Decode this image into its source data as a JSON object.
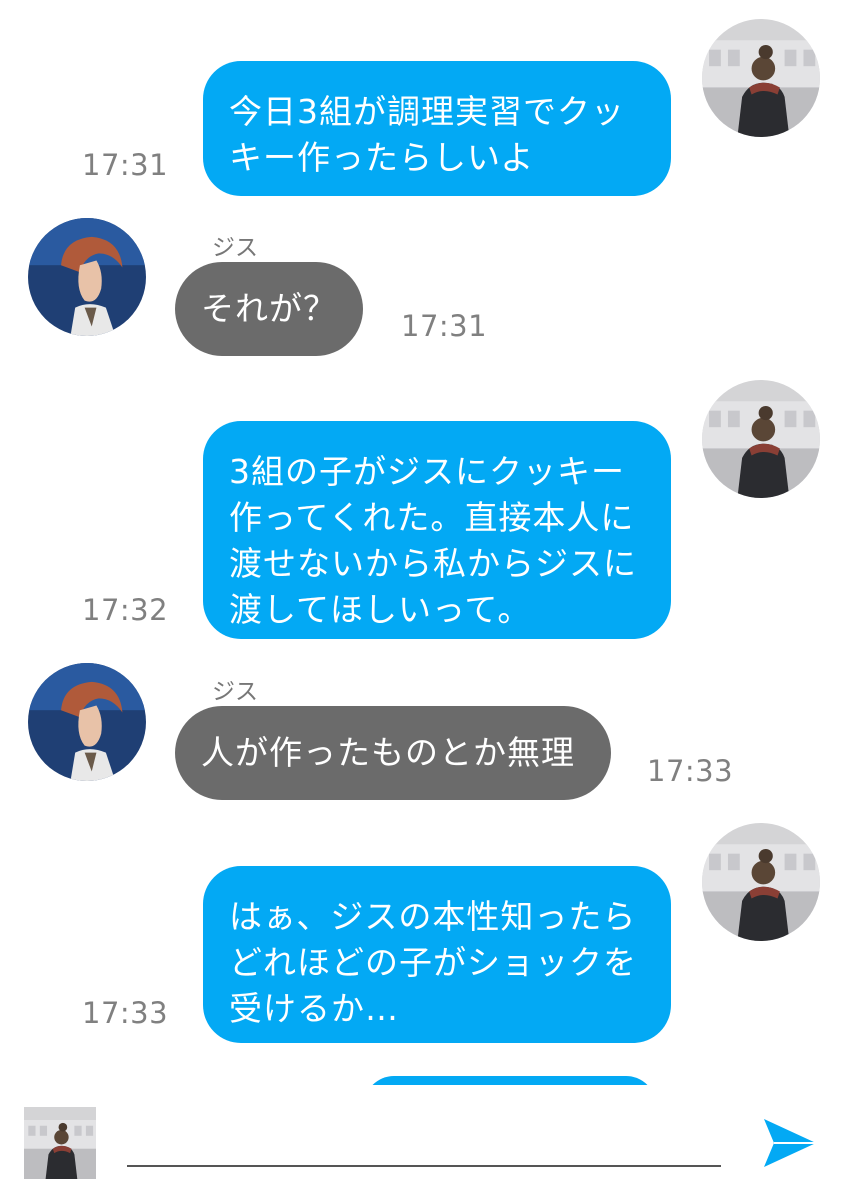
{
  "colors": {
    "my_bubble": "#03a9f4",
    "their_bubble": "#6b6b6b",
    "timestamp": "#808080",
    "send_icon": "#03a9f4"
  },
  "messages": [
    {
      "from": "me",
      "text": "今日3組が調理実習でクッ\nキー作ったらしいよ",
      "time": "17:31"
    },
    {
      "from": "them",
      "sender": "ジス",
      "text": "それが？",
      "time": "17:31"
    },
    {
      "from": "me",
      "text": "3組の子がジスにクッキー\n作ってくれた。直接本人に\n渡せないから私からジスに\n渡してほしいって。",
      "time": "17:32"
    },
    {
      "from": "them",
      "sender": "ジス",
      "text": "人が作ったものとか無理",
      "time": "17:33"
    },
    {
      "from": "me",
      "text": "はぁ、ジスの本性知ったら\nどれほどの子がショックを\n受けるか…",
      "time": "17:33"
    }
  ],
  "composer": {
    "input_value": "",
    "send_icon": "send-arrow-icon"
  }
}
